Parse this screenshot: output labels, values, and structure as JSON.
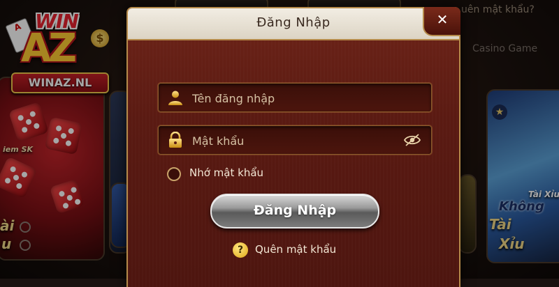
{
  "background": {
    "forgot_hint": "uên mật khẩu?",
    "casino_label": "Casino Game",
    "left_card_text": "ài",
    "left_card_text2": "u",
    "left_card_caption": "iem SK",
    "right_card_title": "Tài Xỉu",
    "right_card_subtitle": "Không",
    "right_card_text1": "Tài",
    "right_card_text2": "Xỉu"
  },
  "logo": {
    "win": "WIN",
    "az": "AZ",
    "domain": "WINAZ.NL"
  },
  "dialog": {
    "title": "Đăng Nhập",
    "close_symbol": "✕",
    "username_placeholder": "Tên đăng nhập",
    "password_placeholder": "Mật khẩu",
    "remember_label": "Nhớ mật khẩu",
    "login_button": "Đăng Nhập",
    "help_symbol": "?",
    "forgot_label": "Quên mật khẩu"
  },
  "icons": {
    "user": "user-icon",
    "lock": "lock-icon",
    "eye": "eye-slash-icon",
    "close": "close-icon",
    "help": "question-icon"
  },
  "colors": {
    "dialog_bg": "#5a1a12",
    "accent_gold": "#b58a4a",
    "header_bg": "#f2ede3",
    "text_light": "#f2e6d4"
  }
}
